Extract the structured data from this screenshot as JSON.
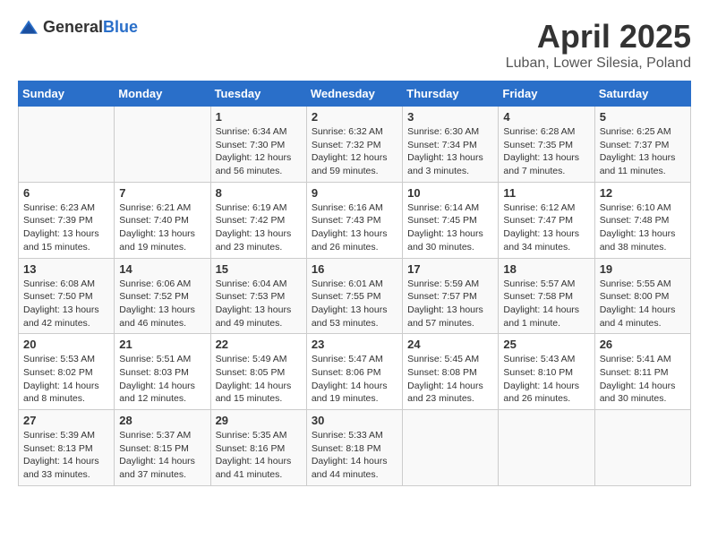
{
  "header": {
    "logo_general": "General",
    "logo_blue": "Blue",
    "month_title": "April 2025",
    "location": "Luban, Lower Silesia, Poland"
  },
  "days_of_week": [
    "Sunday",
    "Monday",
    "Tuesday",
    "Wednesday",
    "Thursday",
    "Friday",
    "Saturday"
  ],
  "weeks": [
    {
      "days": [
        {
          "number": "",
          "info": ""
        },
        {
          "number": "",
          "info": ""
        },
        {
          "number": "1",
          "info": "Sunrise: 6:34 AM\nSunset: 7:30 PM\nDaylight: 12 hours\nand 56 minutes."
        },
        {
          "number": "2",
          "info": "Sunrise: 6:32 AM\nSunset: 7:32 PM\nDaylight: 12 hours\nand 59 minutes."
        },
        {
          "number": "3",
          "info": "Sunrise: 6:30 AM\nSunset: 7:34 PM\nDaylight: 13 hours\nand 3 minutes."
        },
        {
          "number": "4",
          "info": "Sunrise: 6:28 AM\nSunset: 7:35 PM\nDaylight: 13 hours\nand 7 minutes."
        },
        {
          "number": "5",
          "info": "Sunrise: 6:25 AM\nSunset: 7:37 PM\nDaylight: 13 hours\nand 11 minutes."
        }
      ]
    },
    {
      "days": [
        {
          "number": "6",
          "info": "Sunrise: 6:23 AM\nSunset: 7:39 PM\nDaylight: 13 hours\nand 15 minutes."
        },
        {
          "number": "7",
          "info": "Sunrise: 6:21 AM\nSunset: 7:40 PM\nDaylight: 13 hours\nand 19 minutes."
        },
        {
          "number": "8",
          "info": "Sunrise: 6:19 AM\nSunset: 7:42 PM\nDaylight: 13 hours\nand 23 minutes."
        },
        {
          "number": "9",
          "info": "Sunrise: 6:16 AM\nSunset: 7:43 PM\nDaylight: 13 hours\nand 26 minutes."
        },
        {
          "number": "10",
          "info": "Sunrise: 6:14 AM\nSunset: 7:45 PM\nDaylight: 13 hours\nand 30 minutes."
        },
        {
          "number": "11",
          "info": "Sunrise: 6:12 AM\nSunset: 7:47 PM\nDaylight: 13 hours\nand 34 minutes."
        },
        {
          "number": "12",
          "info": "Sunrise: 6:10 AM\nSunset: 7:48 PM\nDaylight: 13 hours\nand 38 minutes."
        }
      ]
    },
    {
      "days": [
        {
          "number": "13",
          "info": "Sunrise: 6:08 AM\nSunset: 7:50 PM\nDaylight: 13 hours\nand 42 minutes."
        },
        {
          "number": "14",
          "info": "Sunrise: 6:06 AM\nSunset: 7:52 PM\nDaylight: 13 hours\nand 46 minutes."
        },
        {
          "number": "15",
          "info": "Sunrise: 6:04 AM\nSunset: 7:53 PM\nDaylight: 13 hours\nand 49 minutes."
        },
        {
          "number": "16",
          "info": "Sunrise: 6:01 AM\nSunset: 7:55 PM\nDaylight: 13 hours\nand 53 minutes."
        },
        {
          "number": "17",
          "info": "Sunrise: 5:59 AM\nSunset: 7:57 PM\nDaylight: 13 hours\nand 57 minutes."
        },
        {
          "number": "18",
          "info": "Sunrise: 5:57 AM\nSunset: 7:58 PM\nDaylight: 14 hours\nand 1 minute."
        },
        {
          "number": "19",
          "info": "Sunrise: 5:55 AM\nSunset: 8:00 PM\nDaylight: 14 hours\nand 4 minutes."
        }
      ]
    },
    {
      "days": [
        {
          "number": "20",
          "info": "Sunrise: 5:53 AM\nSunset: 8:02 PM\nDaylight: 14 hours\nand 8 minutes."
        },
        {
          "number": "21",
          "info": "Sunrise: 5:51 AM\nSunset: 8:03 PM\nDaylight: 14 hours\nand 12 minutes."
        },
        {
          "number": "22",
          "info": "Sunrise: 5:49 AM\nSunset: 8:05 PM\nDaylight: 14 hours\nand 15 minutes."
        },
        {
          "number": "23",
          "info": "Sunrise: 5:47 AM\nSunset: 8:06 PM\nDaylight: 14 hours\nand 19 minutes."
        },
        {
          "number": "24",
          "info": "Sunrise: 5:45 AM\nSunset: 8:08 PM\nDaylight: 14 hours\nand 23 minutes."
        },
        {
          "number": "25",
          "info": "Sunrise: 5:43 AM\nSunset: 8:10 PM\nDaylight: 14 hours\nand 26 minutes."
        },
        {
          "number": "26",
          "info": "Sunrise: 5:41 AM\nSunset: 8:11 PM\nDaylight: 14 hours\nand 30 minutes."
        }
      ]
    },
    {
      "days": [
        {
          "number": "27",
          "info": "Sunrise: 5:39 AM\nSunset: 8:13 PM\nDaylight: 14 hours\nand 33 minutes."
        },
        {
          "number": "28",
          "info": "Sunrise: 5:37 AM\nSunset: 8:15 PM\nDaylight: 14 hours\nand 37 minutes."
        },
        {
          "number": "29",
          "info": "Sunrise: 5:35 AM\nSunset: 8:16 PM\nDaylight: 14 hours\nand 41 minutes."
        },
        {
          "number": "30",
          "info": "Sunrise: 5:33 AM\nSunset: 8:18 PM\nDaylight: 14 hours\nand 44 minutes."
        },
        {
          "number": "",
          "info": ""
        },
        {
          "number": "",
          "info": ""
        },
        {
          "number": "",
          "info": ""
        }
      ]
    }
  ]
}
